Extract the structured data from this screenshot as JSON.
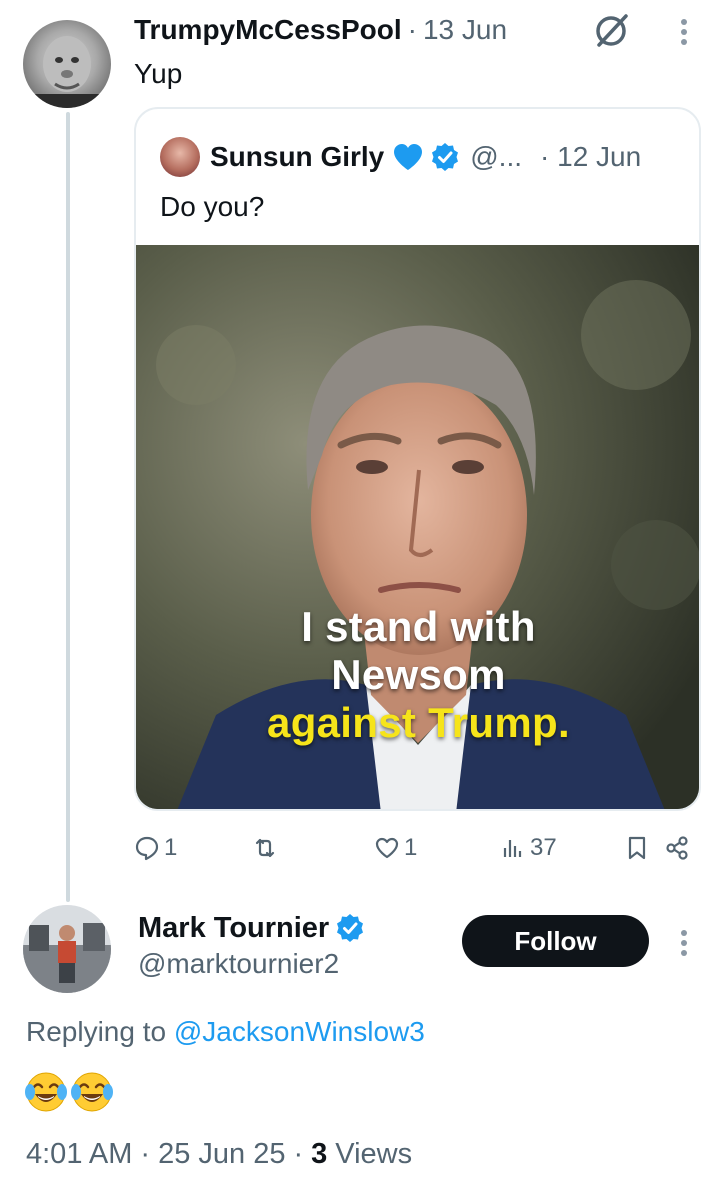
{
  "post1": {
    "author_name": "TrumpyMcCessPool",
    "separator": "·",
    "date": "13 Jun",
    "text": "Yup",
    "avatar_icon": "avatar-image",
    "grok_icon": "grok-icon",
    "more_icon": "more-vertical-icon"
  },
  "quote": {
    "author_name": "Sunsun Girly",
    "handle": "@...",
    "date": "· 12 Jun",
    "text": "Do you?",
    "heart_color": "#1d9bf0",
    "verified_color": "#1d9bf0",
    "image": {
      "caption_line1": "I stand with",
      "caption_line2": "Newsom",
      "caption_line3": "against Trump.",
      "caption_white": "#ffffff",
      "caption_yellow": "#f6e41a"
    }
  },
  "actions": {
    "replies": "1",
    "reposts": "",
    "likes": "1",
    "views": "37"
  },
  "post2": {
    "author_name": "Mark Tournier",
    "handle": "@marktournier2",
    "follow_label": "Follow",
    "replying_prefix": "Replying to ",
    "replying_handle": "@JacksonWinslow3",
    "emoji_count": 2,
    "time": "4:01 AM",
    "separator": "·",
    "date": "25 Jun 25",
    "views_count": "3",
    "views_label": "Views"
  },
  "colors": {
    "text": "#0f1419",
    "secondary": "#536471",
    "link": "#1d9bf0",
    "thread_line": "#cfd9de",
    "follow_bg": "#0f1419"
  }
}
